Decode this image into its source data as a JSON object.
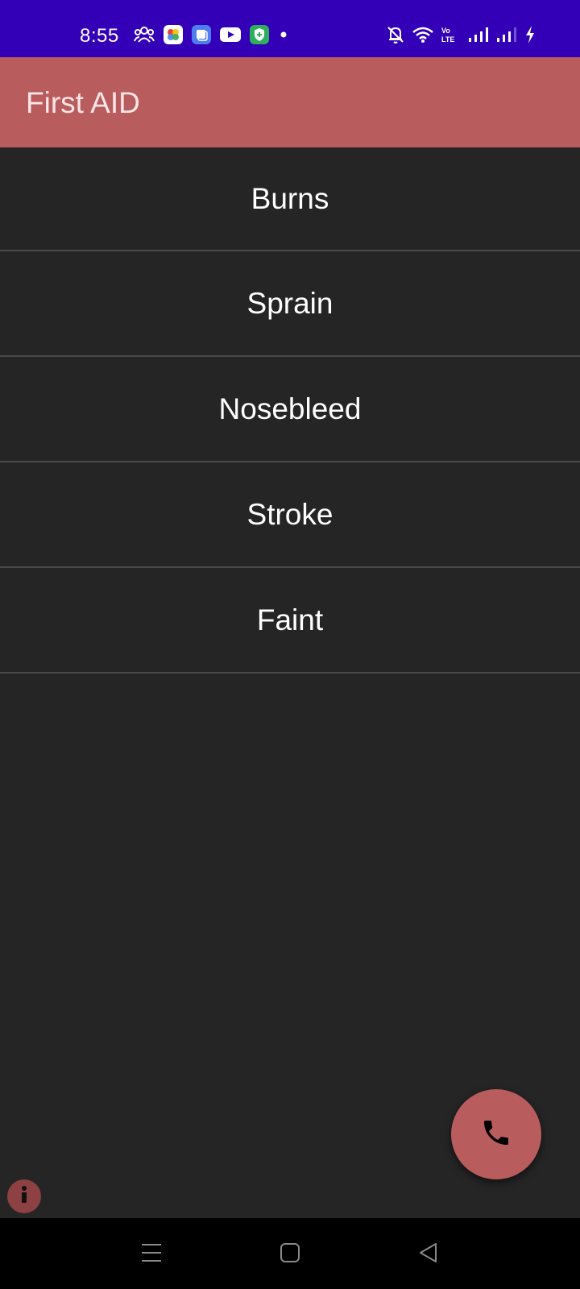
{
  "status_bar": {
    "time": "8:55",
    "background_color": "#3300b7",
    "left_icons": [
      "people-icon",
      "photos-app-icon",
      "app-switcher-icon",
      "youtube-icon",
      "shield-app-icon",
      "notification-dot-icon"
    ],
    "right_icons": [
      "bell-off-icon",
      "wifi-icon",
      "volte-icon",
      "signal-icon",
      "signal-icon-2",
      "charging-icon"
    ]
  },
  "app_bar": {
    "title": "First AID",
    "color": "#b95c5d"
  },
  "list": {
    "items": [
      {
        "label": "Burns"
      },
      {
        "label": "Sprain"
      },
      {
        "label": "Nosebleed"
      },
      {
        "label": "Stroke"
      },
      {
        "label": "Faint"
      }
    ]
  },
  "fab": {
    "icon": "phone-icon",
    "color": "#b95c5d"
  },
  "info_button": {
    "icon": "info-icon"
  },
  "nav_bar": {
    "buttons": [
      "menu-icon",
      "home-icon",
      "back-icon"
    ]
  }
}
